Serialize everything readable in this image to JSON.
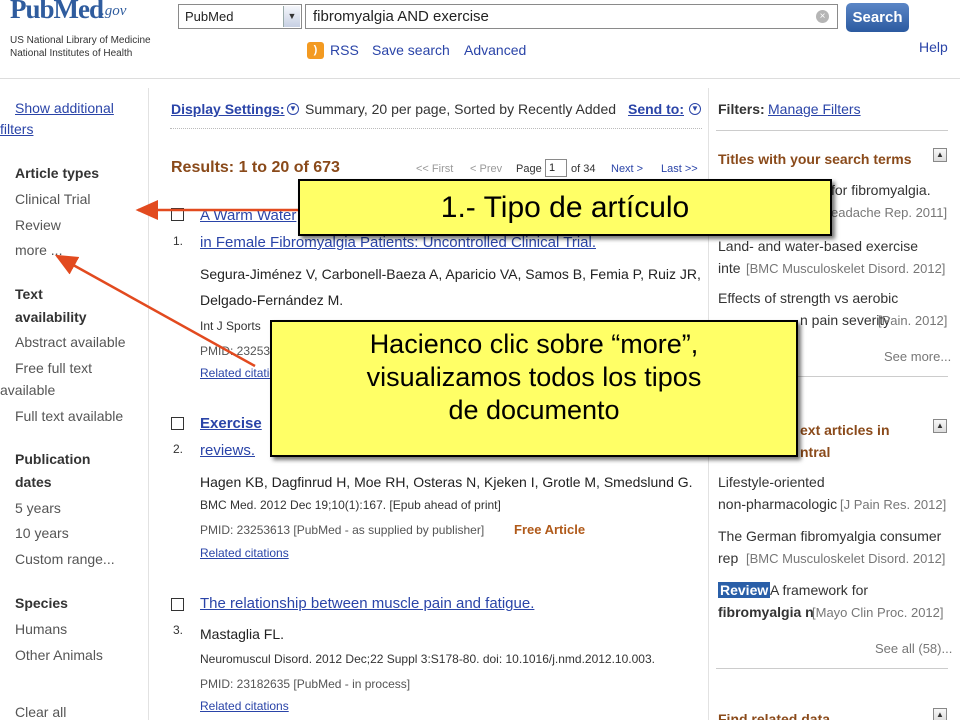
{
  "header": {
    "logo_main": "PubMed",
    "logo_gov": ".gov",
    "org_line1": "US National Library of Medicine",
    "org_line2": "National Institutes of Health",
    "database": "PubMed",
    "query": "fibromyalgia AND exercise",
    "search_label": "Search",
    "links": {
      "rss": "RSS",
      "save_search": "Save search",
      "advanced": "Advanced",
      "help": "Help"
    }
  },
  "sidebar": {
    "show_filters_line1": "Show additional",
    "show_filters_line2": "filters",
    "article_types": {
      "heading": "Article types",
      "items": [
        "Clinical Trial",
        "Review",
        "more ..."
      ]
    },
    "text_availability": {
      "heading_line1": "Text",
      "heading_line2": "availability",
      "items": [
        "Abstract available",
        "Free full text",
        "available",
        "Full text available"
      ]
    },
    "publication_dates": {
      "heading_line1": "Publication",
      "heading_line2": "dates",
      "items": [
        "5 years",
        "10 years",
        "Custom range..."
      ]
    },
    "species": {
      "heading": "Species",
      "items": [
        "Humans",
        "Other Animals"
      ]
    },
    "clear_all": "Clear all"
  },
  "display": {
    "settings_label": "Display Settings:",
    "settings_value": "Summary, 20 per page, Sorted by Recently Added",
    "send_to": "Send to:"
  },
  "results": {
    "summary": "Results: 1 to 20 of 673",
    "pager": {
      "first": "<< First",
      "prev": "< Prev",
      "page_label": "Page",
      "page": "1",
      "of": "of 34",
      "next": "Next >",
      "last": "Last >>"
    },
    "items": [
      {
        "num": "1.",
        "title_a": "A Warm Water",
        "title_b": "in Female Fibromyalgia Patients: Uncontrolled Clinical Trial.",
        "authors_a": "Segura-Jiménez V, Carbonell-Baeza A, Aparicio VA, Samos B, Femia P, Ruiz JR,",
        "authors_b": "Delgado-Fernández M.",
        "source": "Int J Sports",
        "pmid": "PMID: 23253",
        "related": "Related citatio"
      },
      {
        "num": "2.",
        "title_a": "Exercise",
        "title_b": "reviews.",
        "authors": "Hagen KB, Dagfinrud H, Moe RH, Osteras N, Kjeken I, Grotle M, Smedslund G.",
        "source": "BMC Med. 2012 Dec 19;10(1):167. [Epub ahead of print]",
        "pmid": "PMID: 23253613 [PubMed - as supplied by publisher]",
        "free": "Free Article",
        "related": "Related citations"
      },
      {
        "num": "3.",
        "title": "The relationship between muscle pain and fatigue.",
        "authors": "Mastaglia FL.",
        "source": "Neuromuscul Disord. 2012 Dec;22 Suppl 3:S178-80. doi: 10.1016/j.nmd.2012.10.003.",
        "pmid": "PMID: 23182635 [PubMed - in process]",
        "related": "Related citations"
      }
    ]
  },
  "right_column": {
    "filters_label": "Filters:",
    "manage_filters": "Manage Filters",
    "titles_heading": "Titles with your search terms",
    "titles": [
      {
        "line1": "for fibromyalgia.",
        "line2": "eadache Rep. 2011]"
      },
      {
        "line1": "Land- and water-based exercise",
        "line2a": "inte",
        "line2b": "[BMC Musculoskelet Disord. 2012]"
      },
      {
        "line1": "Effects of strength vs aerobic",
        "line2a": "e",
        "line2b": "n pain severity",
        "line2c": "[Pain. 2012]"
      }
    ],
    "see_more": "See more...",
    "pmc_heading_line1": "ext articles in",
    "pmc_heading_line2": "ntral",
    "pmc": [
      {
        "line1": "Lifestyle-oriented",
        "line2a": "non-pharmacologic",
        "line2b": "[J Pain Res. 2012]"
      },
      {
        "line1": "The German fibromyalgia consumer",
        "line2a": "rep",
        "line2b": "[BMC Musculoskelet Disord. 2012]"
      },
      {
        "badge": "Review",
        "line1": "A framework for",
        "line2a": "fibromyalgia n",
        "line2b": "[Mayo Clin Proc. 2012]"
      }
    ],
    "see_all": "See all (58)...",
    "bottom_heading": "Find related data"
  },
  "callouts": {
    "article_type": "1.- Tipo de artículo",
    "more_line1": "Hacienco clic sobre “more”,",
    "more_line2": "visualizamos todos los tipos",
    "more_line3": "de documento"
  },
  "colors": {
    "link": "#2a44a8",
    "callout_fill": "#ffff66",
    "arrow": "#e24a1f",
    "heading_brown": "#8a4a1a"
  }
}
